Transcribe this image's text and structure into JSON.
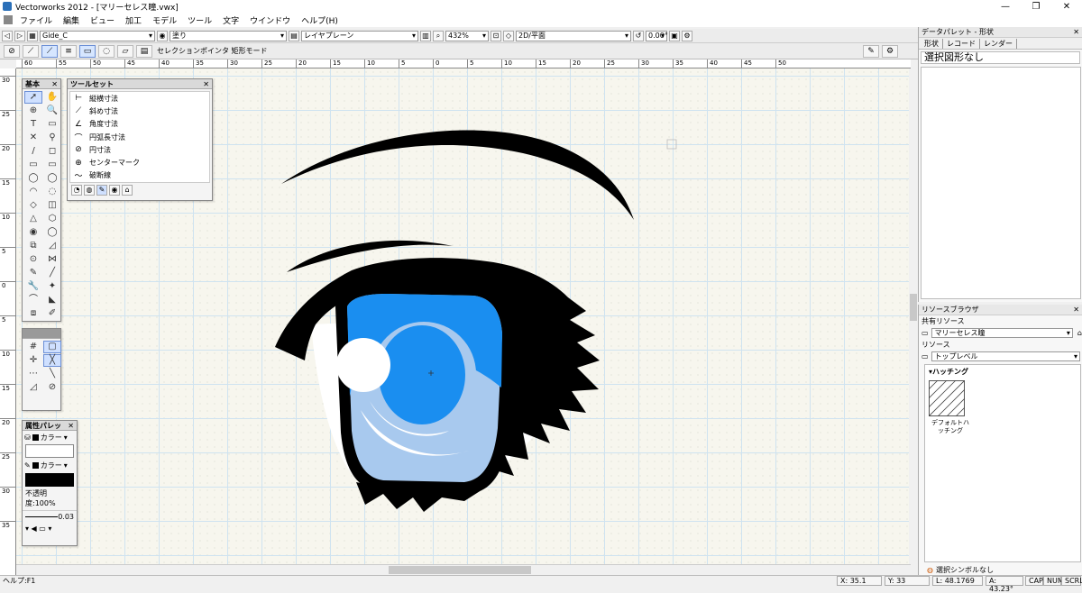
{
  "window": {
    "title": "Vectorworks 2012 - [マリーセレス瞳.vwx]",
    "minimize": "—",
    "maximize": "❐",
    "close": "✕"
  },
  "menu": [
    "ファイル",
    "編集",
    "ビュー",
    "加工",
    "モデル",
    "ツール",
    "文字",
    "ウインドウ",
    "ヘルプ(H)"
  ],
  "viewbar": {
    "class": "Gide_C",
    "fill": "塗り",
    "layer": "レイヤプレーン",
    "zoom": "432%",
    "view": "2D/平面",
    "rotation": "0.00°"
  },
  "modebar": {
    "mode_text": "セレクションポインタ 矩形モード"
  },
  "hruler_labels": [
    "60",
    "55",
    "50",
    "45",
    "40",
    "35",
    "30",
    "25",
    "20",
    "15",
    "10",
    "5",
    "0",
    "5",
    "10",
    "15",
    "20",
    "25",
    "30",
    "35",
    "40",
    "45",
    "50"
  ],
  "vruler_labels": [
    "30",
    "25",
    "20",
    "15",
    "10",
    "5",
    "0",
    "5",
    "10",
    "15",
    "20",
    "25",
    "30",
    "35"
  ],
  "basic_palette": {
    "title": "基本",
    "tools": [
      "➚",
      "✋",
      "⊕",
      "🔍",
      "T",
      "▭",
      "✕",
      "⚲",
      "/",
      "◻",
      "▭",
      "▭",
      "◯",
      "◯",
      "◠",
      "◌",
      "◇",
      "◫",
      "△",
      "⬡",
      "◉",
      "◯",
      "⧉",
      "◿",
      "⊙",
      "⋈",
      "✎",
      "╱",
      "🔧",
      "✦",
      "⌒",
      "◣",
      "⧈",
      "✐"
    ]
  },
  "toolset_palette": {
    "title": "ツールセット",
    "items": [
      {
        "icon": "⊢",
        "label": "縦横寸法"
      },
      {
        "icon": "⟋",
        "label": "斜め寸法"
      },
      {
        "icon": "∠",
        "label": "角度寸法"
      },
      {
        "icon": "⌒",
        "label": "円弧長寸法"
      },
      {
        "icon": "⊘",
        "label": "円寸法"
      },
      {
        "icon": "⊕",
        "label": "センターマーク"
      },
      {
        "icon": "〜",
        "label": "破断線"
      }
    ]
  },
  "snap_palette": {
    "title": ""
  },
  "attribute_palette": {
    "title": "属性パレッ",
    "fill_label": "カラー",
    "pen_label": "カラー",
    "opacity": "不透明度:100%",
    "line_weight": "0.03"
  },
  "status": {
    "help": "ヘルプ:F1",
    "x": "X: 35.1",
    "y": "Y: 33",
    "l": "L: 48.1769",
    "a": "A: 43.23°",
    "cap": "CAP",
    "num": "NUM",
    "scrl": "SCRL"
  },
  "data_palette": {
    "title": "データパレット - 形状",
    "tabs": [
      "形状",
      "レコード",
      "レンダー"
    ],
    "content": "選択図形なし"
  },
  "resource_browser": {
    "title": "リソースブラウザ",
    "shared_label": "共有リソース",
    "shared_file": "マリーセレス瞳",
    "resource_label": "リソース",
    "level": "トップレベル",
    "folder": "ハッチング",
    "item_label": "デフォルトハッチング",
    "footer": "選択シンボルなし"
  },
  "colors": {
    "iris": "#1a8ef0",
    "iris_light": "#a8c9ee",
    "eye_black": "#000000",
    "highlight": "#ffffff",
    "canvas": "#f7f6ee"
  }
}
